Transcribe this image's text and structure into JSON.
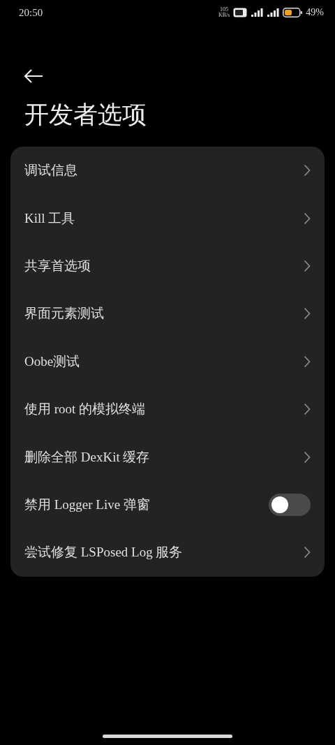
{
  "status_bar": {
    "time": "20:50",
    "net_speed": "105",
    "net_unit": "KB/s",
    "battery": "49%"
  },
  "header": {
    "title": "开发者选项"
  },
  "items": [
    {
      "kind": "link",
      "label": "调试信息"
    },
    {
      "kind": "link",
      "label": "Kill 工具"
    },
    {
      "kind": "link",
      "label": "共享首选项"
    },
    {
      "kind": "link",
      "label": "界面元素测试"
    },
    {
      "kind": "link",
      "label": "Oobe测试"
    },
    {
      "kind": "link",
      "label": "使用 root 的模拟终端"
    },
    {
      "kind": "link",
      "label": "删除全部 DexKit 缓存"
    },
    {
      "kind": "switch",
      "label": "禁用 Logger Live 弹窗",
      "on": false
    },
    {
      "kind": "link",
      "label": "尝试修复 LSPosed Log 服务"
    }
  ]
}
